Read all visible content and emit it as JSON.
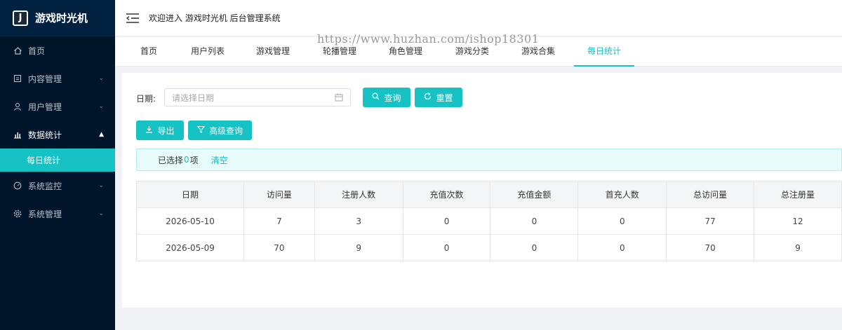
{
  "app": {
    "logo_letter": "J",
    "title": "游戏时光机"
  },
  "header": {
    "welcome": "欢迎进入 游戏时光机 后台管理系统"
  },
  "watermark": "https://www.huzhan.com/ishop18301",
  "sidebar": {
    "items": [
      {
        "label": "首页",
        "icon": "home-icon"
      },
      {
        "label": "内容管理",
        "icon": "document-icon"
      },
      {
        "label": "用户管理",
        "icon": "user-icon"
      },
      {
        "label": "数据统计",
        "icon": "chart-icon"
      },
      {
        "label": "系统监控",
        "icon": "gauge-icon"
      },
      {
        "label": "系统管理",
        "icon": "gear-icon"
      }
    ],
    "submenu_active": "每日统计"
  },
  "tabs": [
    "首页",
    "用户列表",
    "游戏管理",
    "轮播管理",
    "角色管理",
    "游戏分类",
    "游戏合集",
    "每日统计"
  ],
  "active_tab": "每日统计",
  "filter": {
    "date_label": "日期:",
    "date_placeholder": "请选择日期",
    "query_label": "查询",
    "reset_label": "重置",
    "export_label": "导出",
    "advanced_label": "高级查询"
  },
  "selection": {
    "prefix": "已选择",
    "count": "0",
    "suffix": "项",
    "clear": "清空"
  },
  "table": {
    "headers": [
      "日期",
      "访问量",
      "注册人数",
      "充值次数",
      "充值金额",
      "首充人数",
      "总访问量",
      "总注册量"
    ],
    "rows": [
      [
        "2026-05-10",
        "7",
        "3",
        "0",
        "0",
        "0",
        "77",
        "12"
      ],
      [
        "2026-05-09",
        "70",
        "9",
        "0",
        "0",
        "0",
        "70",
        "9"
      ]
    ]
  },
  "colors": {
    "accent": "#16c2c4",
    "sidebar_bg": "#001529"
  }
}
